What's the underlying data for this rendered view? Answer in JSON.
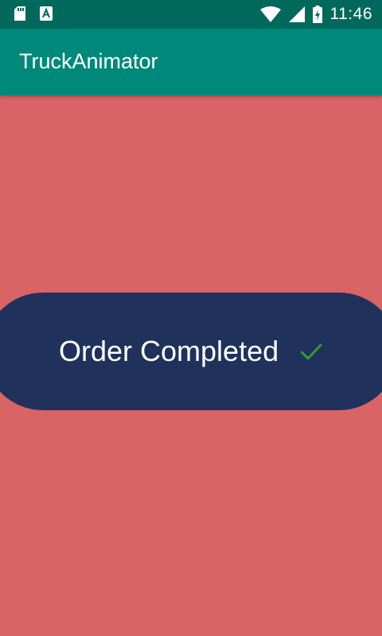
{
  "status_bar": {
    "time": "11:46",
    "icons": [
      "sd-card-icon",
      "a-notification-icon",
      "wifi-icon",
      "signal-icon",
      "battery-charging-icon"
    ]
  },
  "app_bar": {
    "title": "TruckAnimator",
    "color": "#00897b"
  },
  "main": {
    "background_color": "#d96466",
    "order_button": {
      "label": "Order Completed",
      "color": "#20315b",
      "check_color": "#2e9d3a",
      "icon": "check-icon"
    }
  }
}
